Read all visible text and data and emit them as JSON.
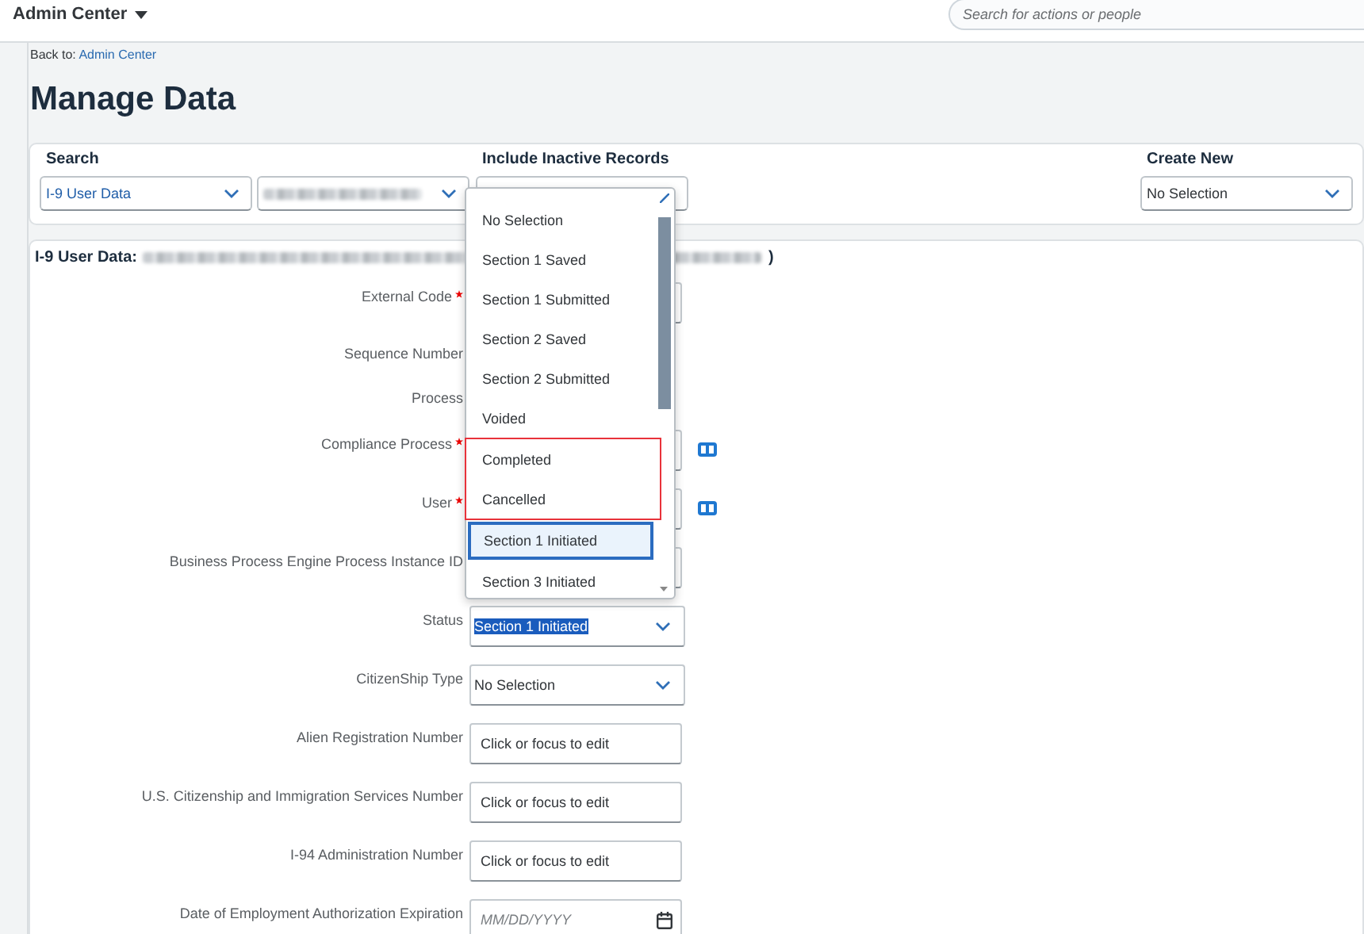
{
  "topbar": {
    "title": "Admin Center",
    "search_placeholder": "Search for actions or people"
  },
  "back_link": {
    "prefix": "Back to:",
    "link": "Admin Center"
  },
  "page_title": "Manage Data",
  "search_panel": [
    {
      "label": "Search",
      "controls": [
        {
          "kind": "select",
          "value": "I-9 User Data"
        },
        {
          "kind": "redacted-select"
        }
      ]
    },
    {
      "label": "Include Inactive Records",
      "controls": [
        {
          "kind": "covered"
        }
      ]
    },
    {
      "label": "Create New",
      "controls": [
        {
          "kind": "select",
          "value": "No Selection"
        }
      ]
    }
  ],
  "record_header": {
    "label": "I-9 User Data:",
    "suffix": ")"
  },
  "fields": [
    {
      "label": "External Code",
      "required": true,
      "kind": "text",
      "lookup": false
    },
    {
      "label": "Sequence Number",
      "required": false,
      "kind": "none",
      "lookup": false
    },
    {
      "label": "Process",
      "required": false,
      "kind": "none",
      "lookup": false
    },
    {
      "label": "Compliance Process",
      "required": true,
      "kind": "text",
      "lookup": true
    },
    {
      "label": "User",
      "required": true,
      "kind": "text",
      "lookup": true
    },
    {
      "label": "Business Process Engine Process Instance ID",
      "required": false,
      "kind": "text",
      "lookup": false
    },
    {
      "label": "Status",
      "required": false,
      "kind": "select",
      "value": "Section 1 Initiated",
      "value_selected": true
    },
    {
      "label": "CitizenShip Type",
      "required": false,
      "kind": "select",
      "value": "No Selection",
      "value_selected": false
    },
    {
      "label": "Alien Registration Number",
      "required": false,
      "kind": "text",
      "placeholder": "Click or focus to edit",
      "lookup": false
    },
    {
      "label": "U.S. Citizenship and Immigration Services Number",
      "required": false,
      "kind": "text",
      "placeholder": "Click or focus to edit",
      "lookup": false
    },
    {
      "label": "I-94 Administration Number",
      "required": false,
      "kind": "text",
      "placeholder": "Click or focus to edit",
      "lookup": false
    },
    {
      "label": "Date of Employment Authorization Expiration",
      "required": false,
      "kind": "date",
      "placeholder": "MM/DD/YYYY",
      "lookup": false
    }
  ],
  "status_dropdown": {
    "options": [
      {
        "label": "No Selection",
        "selected": false,
        "marked": false
      },
      {
        "label": "Section 1 Saved",
        "selected": false,
        "marked": false
      },
      {
        "label": "Section 1 Submitted",
        "selected": false,
        "marked": false
      },
      {
        "label": "Section 2 Saved",
        "selected": false,
        "marked": false
      },
      {
        "label": "Section 2 Submitted",
        "selected": false,
        "marked": false
      },
      {
        "label": "Voided",
        "selected": false,
        "marked": false
      },
      {
        "label": "Completed",
        "selected": false,
        "marked": true
      },
      {
        "label": "Cancelled",
        "selected": false,
        "marked": true
      },
      {
        "label": "Section 1 Initiated",
        "selected": true,
        "marked": false
      },
      {
        "label": "Section 3 Initiated",
        "selected": false,
        "marked": false
      }
    ]
  }
}
